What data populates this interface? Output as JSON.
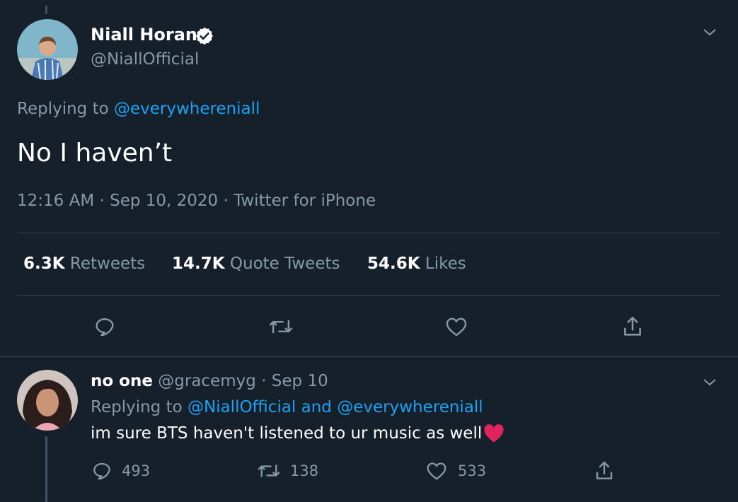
{
  "main_tweet": {
    "author_name": "Niall Horan",
    "handle": "@NiallOfficial",
    "replying_label": "Replying to",
    "replying_to": "@everywhereniall",
    "text": "No I haven’t",
    "timestamp": "12:16 AM · Sep 10, 2020 · Twitter for iPhone",
    "stats": {
      "retweets_count": "6.3K",
      "retweets_label": "Retweets",
      "quotes_count": "14.7K",
      "quotes_label": "Quote Tweets",
      "likes_count": "54.6K",
      "likes_label": "Likes"
    }
  },
  "reply_tweet": {
    "author_name": "no one",
    "handle": "@gracemyg",
    "date": "· Sep 10",
    "replying_label": "Replying to",
    "replying_to_1": "@NiallOfficial",
    "and_label": "and",
    "replying_to_2": "@everywhereniall",
    "text": "im sure BTS haven't listened to ur music as well",
    "reply_count": "493",
    "retweet_count": "138",
    "like_count": "533"
  },
  "icons": {
    "verified": "verified-badge-icon",
    "caret": "chevron-down-icon",
    "reply": "speech-bubble-icon",
    "retweet": "retweet-arrows-icon",
    "like": "heart-icon",
    "share": "share-upload-icon",
    "emoji": "red-heart-emoji"
  },
  "colors": {
    "background": "#15202b",
    "link": "#1da1f2",
    "muted": "#8899a6",
    "verified": "#ffffff",
    "emoji_heart": "#e0245e"
  }
}
